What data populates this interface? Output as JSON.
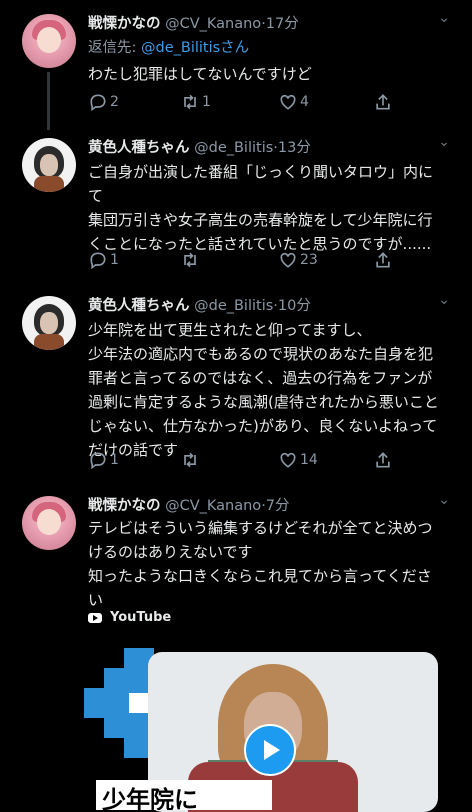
{
  "tweets": [
    {
      "name": "戦慄かなの",
      "handle": "@CV_Kanano",
      "time": "·17分",
      "reply_label": "返信先: ",
      "reply_mention": "@de_Bilitisさん",
      "text": "わたし犯罪はしてないんですけど",
      "replies": "2",
      "retweets": "1",
      "likes": "4"
    },
    {
      "name": "黄色人種ちゃん",
      "handle": "@de_Bilitis",
      "time": "·13分",
      "text": "ご自身が出演した番組「じっくり聞いタロウ」内に\nて\n集団万引きや女子高生の売春幹旋をして少年院に行\nくことになったと話されていたと思うのですが......",
      "replies": "1",
      "retweets": "",
      "likes": "23"
    },
    {
      "name": "黄色人種ちゃん",
      "handle": "@de_Bilitis",
      "time": "·10分",
      "text": "少年院を出て更生されたと仰ってますし、\n少年法の適応内でもあるので現状のあなた自身を犯\n罪者と言ってるのではなく、過去の行為をファンが\n過剰に肯定するような風潮(虐待されたから悪いこと\nじゃない、仕方なかった)があり、良くないよねって\nだけの話です",
      "replies": "1",
      "retweets": "",
      "likes": "14"
    },
    {
      "name": "戦慄かなの",
      "handle": "@CV_Kanano",
      "time": "·7分",
      "text": "テレビはそういう編集するけどそれが全てと決めつ\nけるのはありえないです\n知ったような口きくならこれ見てから言ってくださ\nい",
      "card_source": "YouTube",
      "caption": "少年院に"
    }
  ],
  "colors": {
    "background": "#000000",
    "text": "#e7e9ea",
    "muted": "#8b98a5",
    "link": "#1d9bf0"
  }
}
